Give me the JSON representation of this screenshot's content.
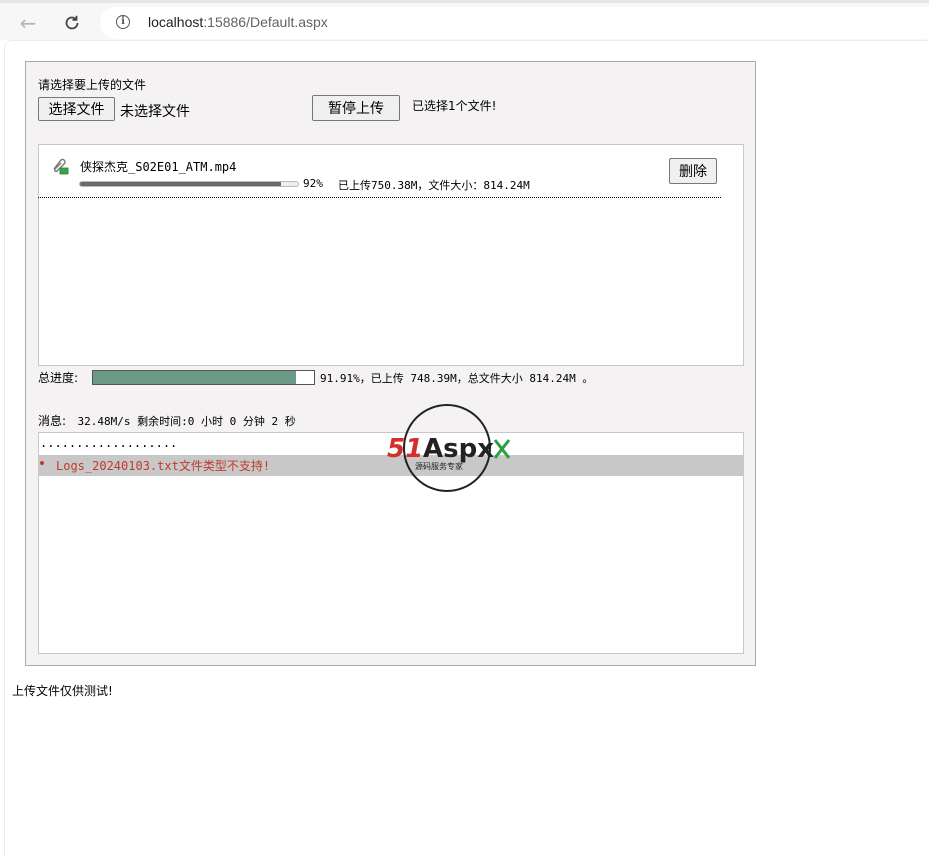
{
  "browser": {
    "url_host": "localhost",
    "url_rest": ":15886/Default.aspx"
  },
  "uploader": {
    "choose_label": "请选择要上传的文件",
    "choose_button": "选择文件",
    "no_file_text": "未选择文件",
    "pause_button": "暂停上传",
    "selected_count": "已选择1个文件!"
  },
  "file_item": {
    "name": "侠探杰克_S02E01_ATM.mp4",
    "percent_text": "92%",
    "progress": 0.92,
    "status": "已上传750.38M，文件大小：814.24M",
    "delete_button": "删除"
  },
  "total": {
    "label": "总进度:",
    "progress": 0.9191,
    "status": "91.91%，已上传 748.39M，总文件大小 814.24M 。"
  },
  "message": {
    "label": "消息:",
    "text": "32.48M/s   剩余时间:0 小时 0 分钟 2 秒"
  },
  "log": {
    "dots": "...................",
    "error": "Logs_20240103.txt文件类型不支持!"
  },
  "watermark": {
    "brand_51": "51",
    "brand_aspx": "Aspx",
    "tagline": "源码服务专家"
  },
  "footer": {
    "note": "上传文件仅供测试!"
  },
  "colors": {
    "total_fill": "#6a9a86",
    "error_text": "#c23a2b",
    "error_row_bg": "#c8c8c8"
  }
}
